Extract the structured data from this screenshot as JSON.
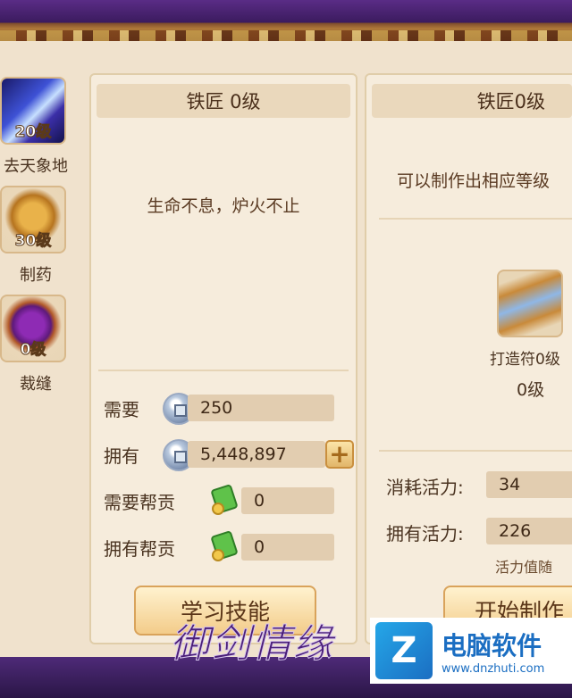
{
  "skills": [
    {
      "name": "去天象地",
      "level": "20级",
      "icon": "sword-icon"
    },
    {
      "name": "制药",
      "level": "30级",
      "icon": "medicine-pot-icon"
    },
    {
      "name": "裁缝",
      "level": "0级",
      "icon": "thread-spool-icon"
    }
  ],
  "left_card": {
    "title": "铁匠 0级",
    "description": "生命不息，炉火不止",
    "need_label": "需要",
    "need_value": "250",
    "have_label": "拥有",
    "have_value": "5,448,897",
    "need_contrib_label": "需要帮贡",
    "need_contrib_value": "0",
    "have_contrib_label": "拥有帮贡",
    "have_contrib_value": "0",
    "learn_button": "学习技能"
  },
  "right_card": {
    "title": "铁匠0级",
    "description": "可以制作出相应等级",
    "item_name": "打造符0级",
    "item_level": "0级",
    "consume_label": "消耗活力:",
    "consume_value": "34",
    "own_label": "拥有活力:",
    "own_value": "226",
    "note": "活力值随",
    "start_button": "开始制作"
  },
  "watermark": {
    "game_logo": "御剑情缘",
    "site_name": "电脑软件",
    "site_url": "www.dnzhuti.com",
    "site_letter": "Z"
  },
  "colors": {
    "panel": "#f0e2cd",
    "card": "#f6ecdc",
    "text": "#4a3320",
    "accent": "#e2b66a"
  }
}
